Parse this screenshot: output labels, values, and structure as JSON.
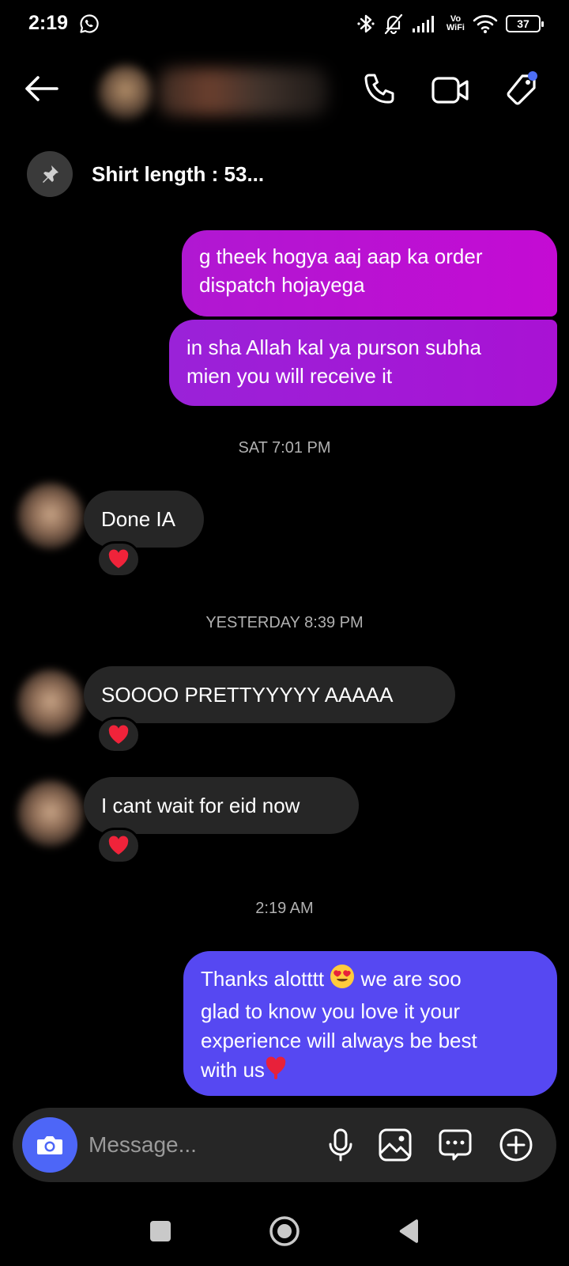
{
  "status_bar": {
    "time": "2:19",
    "vowifi_top": "Vo",
    "vowifi_bottom": "WiFi",
    "battery": "37",
    "icons": [
      "whatsapp-icon",
      "bluetooth-icon",
      "bell-off-icon",
      "signal-icon",
      "wifi-icon",
      "battery-icon"
    ]
  },
  "header": {
    "icons": [
      "back-arrow-icon",
      "phone-icon",
      "video-icon",
      "tag-icon"
    ],
    "tag_dot_color": "#4d6ef5"
  },
  "pinned": {
    "text": "Shirt length : 53...",
    "icon": "pin-icon"
  },
  "messages": [
    {
      "from": "me",
      "lines": [
        "g theek hogya aaj aap ka order",
        "dispatch hojayega"
      ]
    },
    {
      "from": "me",
      "lines": [
        "in sha Allah kal ya purson subha",
        "mien you will receive it"
      ]
    },
    {
      "type": "timestamp",
      "text": "SAT 7:01 PM"
    },
    {
      "from": "them",
      "text": "Done IA",
      "reaction": "heart"
    },
    {
      "type": "timestamp",
      "text": "YESTERDAY 8:39 PM"
    },
    {
      "from": "them",
      "text": "SOOOO PRETTYYYYY AAAAA",
      "reaction": "heart"
    },
    {
      "from": "them",
      "text": "I cant wait for eid now",
      "reaction": "heart"
    },
    {
      "type": "timestamp",
      "text": "2:19 AM"
    },
    {
      "from": "me",
      "line1_a": "Thanks alotttt",
      "line1_b": "we are soo",
      "line2": "glad to know you love it  your",
      "line3": "experience will always be best",
      "line4": "with us"
    }
  ],
  "composer": {
    "placeholder": "Message...",
    "icons": [
      "camera-icon",
      "mic-icon",
      "gallery-icon",
      "sticker-icon",
      "plus-icon"
    ]
  },
  "colors": {
    "bubble_out_1": "#c40bd3",
    "bubble_out_2": "#a912d4",
    "bubble_out_3": "#5648f2",
    "bubble_in": "#262626",
    "camera_button": "#4d66f7"
  }
}
